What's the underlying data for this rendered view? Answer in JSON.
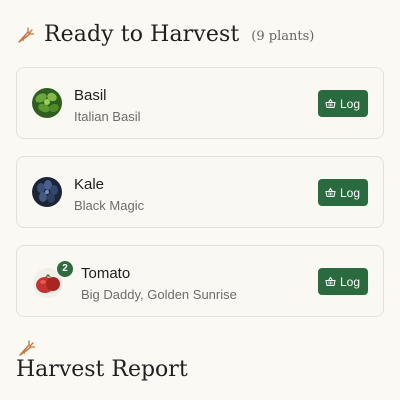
{
  "ready_section": {
    "title": "Ready to Harvest",
    "count": "(9 plants)"
  },
  "plants": [
    {
      "name": "Basil",
      "variety": "Italian Basil",
      "action": "Log",
      "thumb_color": "#3f7a2a"
    },
    {
      "name": "Kale",
      "variety": "Black Magic",
      "action": "Log",
      "thumb_color": "#2b3d5a"
    },
    {
      "name": "Tomato",
      "variety": "Big Daddy, Golden Sunrise",
      "action": "Log",
      "badge": "2",
      "thumb_color": "#c8322e"
    }
  ],
  "report_section": {
    "title": "Harvest Report"
  },
  "colors": {
    "accent": "#2a6a3f",
    "background": "#fbf9f4",
    "carrot": "#c8773f"
  },
  "icons": {
    "header": "carrot-icon",
    "action": "basket-icon"
  }
}
